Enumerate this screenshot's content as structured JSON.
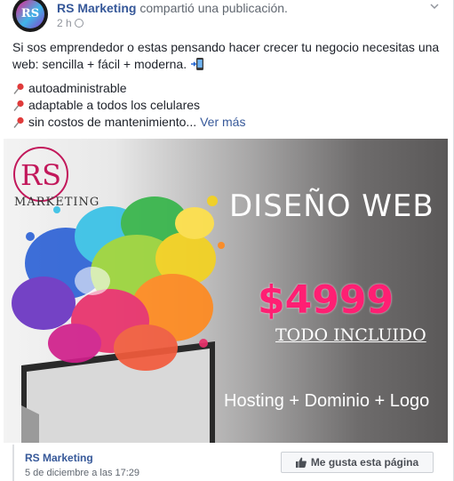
{
  "post": {
    "page_name": "RS Marketing",
    "action_text": "compartió una publicación.",
    "time": "2 h",
    "body": "Si sos emprendedor o estas pensando hacer crecer tu negocio necesitas una web: sencilla + fácil + moderna.",
    "bullets": [
      "autoadministrable",
      "adaptable a todos los celulares",
      "sin costos de mantenimiento..."
    ],
    "see_more": "Ver más"
  },
  "banner": {
    "logo_word": "Marketing",
    "title": "DISEÑO WEB",
    "price": "$4999",
    "included": "TODO INCLUIDO",
    "services": "Hosting + Dominio + Logo"
  },
  "footer": {
    "page_name": "RS Marketing",
    "date": "5 de diciembre a las 17:29",
    "like_page_label": "Me gusta esta página"
  },
  "colors": {
    "link": "#365899",
    "price": "#ff1f73",
    "logo": "#c2185b"
  },
  "icons": [
    "avatar-logo",
    "globe-icon",
    "chevron-down-icon",
    "phone-icon",
    "pushpin-icon",
    "thumbs-up-icon"
  ]
}
